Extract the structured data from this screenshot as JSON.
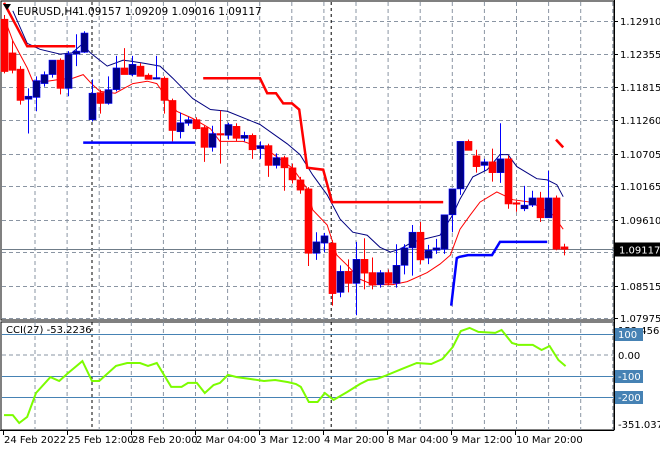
{
  "header": {
    "symbol": "EURUSD,H4",
    "ohlc": "1.09157 1.09209 1.09016 1.09117",
    "menu_icon": "triangle-down-icon"
  },
  "colors": {
    "bull": "#000080",
    "bear": "#ff0000",
    "ma_fast": "#ff0000",
    "ma_slow": "#000080",
    "upper_stop": "#ff0000",
    "lower_stop": "#0000ff",
    "cci": "#7cfc00",
    "cci_level": "#4682b4",
    "grid": "#8a95a3",
    "price_label_bg": "#000000"
  },
  "chart_data": {
    "type": "candlestick",
    "title": "EURUSD,H4",
    "ylim": [
      1.07975,
      1.1291
    ],
    "y_ticks": [
      "1.12910",
      "1.12355",
      "1.11815",
      "1.11260",
      "1.10705",
      "1.10165",
      "1.09610",
      "1.08515",
      "1.07975"
    ],
    "y_tick_values": [
      1.1291,
      1.12355,
      1.11815,
      1.1126,
      1.10705,
      1.10165,
      1.0961,
      1.08515,
      1.07975
    ],
    "current_price": "1.09117",
    "current_price_value": 1.09117,
    "x_ticks": [
      {
        "index": 0,
        "label": "24 Feb 2022"
      },
      {
        "index": 8,
        "label": "25 Feb 12:00"
      },
      {
        "index": 16,
        "label": "28 Feb 20:00"
      },
      {
        "index": 24,
        "label": "2 Mar 04:00"
      },
      {
        "index": 32,
        "label": "3 Mar 12:00"
      },
      {
        "index": 40,
        "label": "4 Mar 20:00"
      },
      {
        "index": 48,
        "label": "8 Mar 04:00"
      },
      {
        "index": 56,
        "label": "9 Mar 12:00"
      },
      {
        "index": 64,
        "label": "10 Mar 20:00"
      }
    ],
    "period_separators": [
      11,
      40.9
    ],
    "candles": [
      [
        1.1294,
        1.1301,
        1.1204,
        1.1207
      ],
      [
        1.1238,
        1.1258,
        1.1204,
        1.1209
      ],
      [
        1.1211,
        1.1216,
        1.1152,
        1.1159
      ],
      [
        1.1161,
        1.1179,
        1.1104,
        1.1166
      ],
      [
        1.1164,
        1.1199,
        1.1141,
        1.1192
      ],
      [
        1.1187,
        1.1207,
        1.1182,
        1.1202
      ],
      [
        1.1202,
        1.1226,
        1.1197,
        1.1226
      ],
      [
        1.1226,
        1.1229,
        1.1169,
        1.1179
      ],
      [
        1.1179,
        1.1241,
        1.1166,
        1.1236
      ],
      [
        1.1236,
        1.1269,
        1.1216,
        1.1241
      ],
      [
        1.1239,
        1.1274,
        1.1238,
        1.1271
      ],
      [
        1.1127,
        1.1194,
        1.1124,
        1.1171
      ],
      [
        1.1172,
        1.1177,
        1.1137,
        1.1154
      ],
      [
        1.1154,
        1.1199,
        1.1152,
        1.1177
      ],
      [
        1.1177,
        1.1233,
        1.1174,
        1.1213
      ],
      [
        1.1213,
        1.1246,
        1.1202,
        1.1202
      ],
      [
        1.1202,
        1.1233,
        1.1199,
        1.1219
      ],
      [
        1.1216,
        1.1221,
        1.1199,
        1.1199
      ],
      [
        1.1201,
        1.1204,
        1.1194,
        1.1194
      ],
      [
        1.1196,
        1.1233,
        1.1194,
        1.1197
      ],
      [
        1.1196,
        1.1199,
        1.1137,
        1.1159
      ],
      [
        1.1159,
        1.1162,
        1.1091,
        1.1109
      ],
      [
        1.1107,
        1.1139,
        1.1096,
        1.1122
      ],
      [
        1.1121,
        1.1132,
        1.1117,
        1.1127
      ],
      [
        1.1127,
        1.1131,
        1.1111,
        1.1112
      ],
      [
        1.1114,
        1.1117,
        1.1057,
        1.1081
      ],
      [
        1.1081,
        1.1117,
        1.1074,
        1.1104
      ],
      [
        1.1104,
        1.1142,
        1.1054,
        1.1102
      ],
      [
        1.1101,
        1.1122,
        1.1094,
        1.1119
      ],
      [
        1.1116,
        1.1121,
        1.1091,
        1.1096
      ],
      [
        1.1096,
        1.1107,
        1.1091,
        1.1101
      ],
      [
        1.1101,
        1.1104,
        1.1062,
        1.1077
      ],
      [
        1.1079,
        1.1091,
        1.1062,
        1.1084
      ],
      [
        1.1084,
        1.1087,
        1.1032,
        1.1051
      ],
      [
        1.1051,
        1.1071,
        1.1046,
        1.1064
      ],
      [
        1.1064,
        1.1067,
        1.1009,
        1.1047
      ],
      [
        1.1047,
        1.1054,
        1.1021,
        1.1027
      ],
      [
        1.1027,
        1.1032,
        1.1004,
        1.101
      ],
      [
        1.1012,
        1.1015,
        1.0884,
        1.0905
      ],
      [
        1.0905,
        1.094,
        1.0894,
        1.0924
      ],
      [
        1.0922,
        1.0939,
        1.0907,
        1.0934
      ],
      [
        1.0922,
        1.0927,
        1.0818,
        1.0838
      ],
      [
        1.084,
        1.0885,
        1.0832,
        1.0875
      ],
      [
        1.0875,
        1.0895,
        1.084,
        1.0855
      ],
      [
        1.0855,
        1.0924,
        1.0802,
        1.0895
      ],
      [
        1.0895,
        1.093,
        1.0845,
        1.0872
      ],
      [
        1.0873,
        1.0898,
        1.0845,
        1.0852
      ],
      [
        1.0853,
        1.0877,
        1.0848,
        1.0873
      ],
      [
        1.0873,
        1.0878,
        1.0852,
        1.0855
      ],
      [
        1.0855,
        1.092,
        1.0848,
        1.0885
      ],
      [
        1.0885,
        1.092,
        1.087,
        1.0914
      ],
      [
        1.0914,
        1.0952,
        1.0868,
        1.094
      ],
      [
        1.094,
        1.0957,
        1.0887,
        1.0894
      ],
      [
        1.0897,
        1.0919,
        1.0887,
        1.091
      ],
      [
        1.091,
        1.0929,
        1.0904,
        1.0914
      ],
      [
        1.0912,
        1.0924,
        1.0904,
        1.0969
      ],
      [
        1.0969,
        1.099,
        1.094,
        1.1012
      ],
      [
        1.1012,
        1.1091,
        1.1002,
        1.1091
      ],
      [
        1.1091,
        1.1094,
        1.1076,
        1.1076
      ],
      [
        1.1067,
        1.1077,
        1.1039,
        1.1049
      ],
      [
        1.1051,
        1.1062,
        1.1042,
        1.1057
      ],
      [
        1.1057,
        1.1079,
        1.1024,
        1.1039
      ],
      [
        1.1039,
        1.1121,
        1.1022,
        1.1062
      ],
      [
        1.1062,
        1.1067,
        1.0979,
        1.0987
      ],
      [
        1.0989,
        1.0992,
        1.0974,
        1.0987
      ],
      [
        1.0979,
        1.1017,
        1.0975,
        1.0985
      ],
      [
        1.0985,
        1.1009,
        1.0982,
        1.0997
      ],
      [
        1.0997,
        1.1007,
        1.0957,
        1.0964
      ],
      [
        1.0964,
        1.1042,
        1.0964,
        1.0997
      ],
      [
        1.0997,
        1.1001,
        1.091,
        1.0912
      ],
      [
        1.09157,
        1.09209,
        1.09016,
        1.09117
      ]
    ],
    "overlays": {
      "ma_slow": [
        [
          1.1,
          1.1308
        ],
        [
          2.9,
          1.1254
        ],
        [
          4.5,
          1.1244
        ],
        [
          7,
          1.1236
        ],
        [
          8.5,
          1.1238
        ],
        [
          9.8,
          1.1253
        ],
        [
          10.8,
          1.1238
        ],
        [
          12.9,
          1.1216
        ],
        [
          14.9,
          1.1226
        ],
        [
          17.4,
          1.1221
        ],
        [
          19.5,
          1.1216
        ],
        [
          21.1,
          1.1196
        ],
        [
          23.6,
          1.1162
        ],
        [
          25.8,
          1.1144
        ],
        [
          27.9,
          1.1141
        ],
        [
          32,
          1.1119
        ],
        [
          35.4,
          1.1087
        ],
        [
          37,
          1.1069
        ],
        [
          38.6,
          1.1035
        ],
        [
          40.4,
          1.1002
        ],
        [
          42,
          1.0962
        ],
        [
          43.6,
          1.094
        ],
        [
          45.4,
          1.0935
        ],
        [
          47,
          1.0915
        ],
        [
          48.3,
          1.0907
        ],
        [
          49.5,
          1.0912
        ],
        [
          51.1,
          1.0924
        ],
        [
          54.5,
          1.0935
        ],
        [
          56.1,
          1.0969
        ],
        [
          57,
          1.0995
        ],
        [
          58.6,
          1.1032
        ],
        [
          60.4,
          1.1044
        ],
        [
          62,
          1.1069
        ],
        [
          63,
          1.1069
        ],
        [
          64.1,
          1.1049
        ],
        [
          66.6,
          1.1029
        ],
        [
          67.9,
          1.1027
        ],
        [
          69.1,
          1.1019
        ],
        [
          69.9,
          1.0999
        ]
      ],
      "ma_fast": [
        [
          0.1,
          1.1294
        ],
        [
          1.1,
          1.1258
        ],
        [
          2.9,
          1.1213
        ],
        [
          3.6,
          1.1191
        ],
        [
          5.4,
          1.1191
        ],
        [
          7,
          1.1194
        ],
        [
          8.6,
          1.1196
        ],
        [
          9.9,
          1.1202
        ],
        [
          11,
          1.1186
        ],
        [
          12,
          1.1174
        ],
        [
          13.9,
          1.1171
        ],
        [
          16.1,
          1.1187
        ],
        [
          17.9,
          1.1191
        ],
        [
          19.1,
          1.1187
        ],
        [
          20.4,
          1.1162
        ],
        [
          21.6,
          1.1141
        ],
        [
          23.6,
          1.1129
        ],
        [
          25.8,
          1.1112
        ],
        [
          27,
          1.1091
        ],
        [
          29.9,
          1.1091
        ],
        [
          32.9,
          1.1077
        ],
        [
          36.1,
          1.1046
        ],
        [
          37.9,
          1.1012
        ],
        [
          38.6,
          1.0977
        ],
        [
          40.4,
          1.0952
        ],
        [
          41.6,
          1.0902
        ],
        [
          42.9,
          1.0885
        ],
        [
          44.5,
          1.0862
        ],
        [
          46.1,
          1.0853
        ],
        [
          48.6,
          1.0853
        ],
        [
          50.4,
          1.0858
        ],
        [
          52.9,
          1.0873
        ],
        [
          54.5,
          1.0887
        ],
        [
          55.8,
          1.0902
        ],
        [
          57,
          1.0945
        ],
        [
          58.3,
          1.0969
        ],
        [
          59.5,
          1.099
        ],
        [
          61.6,
          1.1007
        ],
        [
          63.6,
          1.0994
        ],
        [
          65.8,
          1.099
        ],
        [
          67.4,
          1.0979
        ],
        [
          68.6,
          1.0969
        ],
        [
          69.9,
          1.0945
        ]
      ],
      "upper_stop": [
        [
          [
            0,
            1.1321
          ],
          [
            2.9,
            1.1249
          ],
          [
            8.9,
            1.1249
          ]
        ],
        [
          [
            24.9,
            1.1196
          ],
          [
            32,
            1.1196
          ],
          [
            32.9,
            1.1171
          ],
          [
            34,
            1.1171
          ],
          [
            34.9,
            1.1154
          ],
          [
            36,
            1.1154
          ],
          [
            36.9,
            1.1144
          ],
          [
            37.9,
            1.1047
          ],
          [
            39.9,
            1.1044
          ],
          [
            41,
            1.099
          ],
          [
            54.9,
            1.099
          ]
        ],
        [
          [
            69,
            1.1094
          ],
          [
            69.9,
            1.1081
          ]
        ]
      ],
      "lower_stop": [
        [
          [
            9.9,
            1.1089
          ],
          [
            23.9,
            1.1089
          ]
        ],
        [
          [
            55.9,
            1.0818
          ],
          [
            56.6,
            1.0897
          ],
          [
            56.9,
            1.0899
          ],
          [
            58,
            1.0902
          ],
          [
            61,
            1.0902
          ],
          [
            62,
            1.0924
          ],
          [
            67.9,
            1.0924
          ]
        ]
      ]
    },
    "cci": {
      "label": "CCI(27) -53.2236",
      "range": [
        -351.0371,
        153.4568
      ],
      "levels": [
        100,
        -100,
        -200
      ],
      "axis_labels": [
        {
          "value": 153.4568,
          "label": "153.4568",
          "boxed": false
        },
        {
          "value": 100,
          "label": "100",
          "boxed": true
        },
        {
          "value": 0,
          "label": "0.00",
          "boxed": false
        },
        {
          "value": -100,
          "label": "-100",
          "boxed": true
        },
        {
          "value": -200,
          "label": "-200",
          "boxed": true
        },
        {
          "value": -351.0371,
          "label": "-351.0371",
          "boxed": false
        }
      ],
      "points": [
        [
          0,
          -286
        ],
        [
          1.1,
          -286
        ],
        [
          1.9,
          -324
        ],
        [
          2.9,
          -295
        ],
        [
          4,
          -181
        ],
        [
          5.8,
          -105
        ],
        [
          6.9,
          -124
        ],
        [
          8,
          -86
        ],
        [
          9.8,
          -29
        ],
        [
          11,
          -124
        ],
        [
          11.9,
          -124
        ],
        [
          14,
          -52
        ],
        [
          15.4,
          -38
        ],
        [
          17,
          -38
        ],
        [
          18,
          -52
        ],
        [
          19.1,
          -38
        ],
        [
          20.9,
          -152
        ],
        [
          22.2,
          -152
        ],
        [
          23,
          -133
        ],
        [
          24.1,
          -133
        ],
        [
          25.1,
          -181
        ],
        [
          26.2,
          -143
        ],
        [
          27,
          -133
        ],
        [
          28,
          -95
        ],
        [
          29.1,
          -105
        ],
        [
          30.7,
          -114
        ],
        [
          32.5,
          -124
        ],
        [
          33.9,
          -119
        ],
        [
          35.5,
          -129
        ],
        [
          36.5,
          -138
        ],
        [
          37.1,
          -152
        ],
        [
          38.1,
          -224
        ],
        [
          39.2,
          -224
        ],
        [
          40.1,
          -181
        ],
        [
          41.2,
          -214
        ],
        [
          42.9,
          -176
        ],
        [
          44.5,
          -138
        ],
        [
          45.5,
          -119
        ],
        [
          46.6,
          -114
        ],
        [
          47.6,
          -100
        ],
        [
          49.7,
          -67
        ],
        [
          51.6,
          -38
        ],
        [
          53.4,
          -43
        ],
        [
          54.8,
          -19
        ],
        [
          56.1,
          38
        ],
        [
          57.1,
          114
        ],
        [
          58.2,
          129
        ],
        [
          59.3,
          110
        ],
        [
          61.4,
          105
        ],
        [
          62.2,
          119
        ],
        [
          63.5,
          57
        ],
        [
          64.3,
          48
        ],
        [
          66.1,
          48
        ],
        [
          67.2,
          24
        ],
        [
          68.2,
          43
        ],
        [
          69.3,
          -24
        ],
        [
          70.2,
          -53
        ]
      ]
    }
  }
}
